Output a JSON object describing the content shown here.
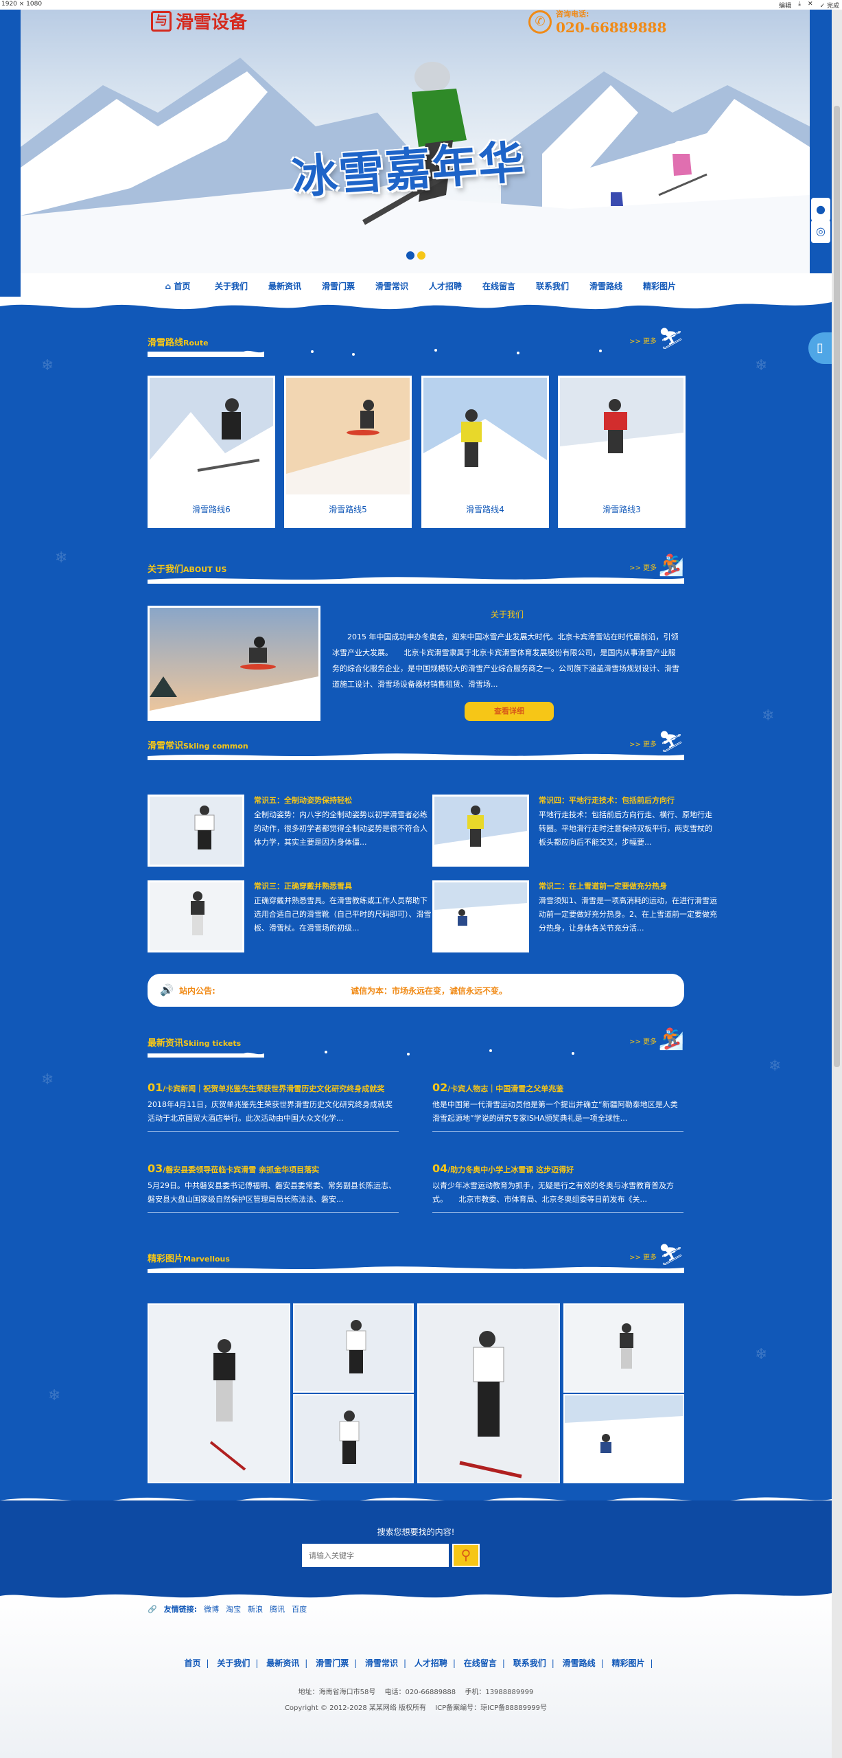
{
  "viewer": {
    "dimensions": "1920 × 1080",
    "tools": [
      "编辑",
      "⤓",
      "✕",
      "✓ 完成"
    ]
  },
  "header": {
    "logo_text": "滑雪设备",
    "logo_mark": "与",
    "hotline_label": "咨询电话:",
    "hotline_number": "020-66889888"
  },
  "hero": {
    "title": "冰雪嘉年华"
  },
  "nav": {
    "items": [
      "首页",
      "关于我们",
      "最新资讯",
      "滑雪门票",
      "滑雪常识",
      "人才招聘",
      "在线留言",
      "联系我们",
      "滑雪路线",
      "精彩图片"
    ]
  },
  "sections": {
    "route": {
      "title": "滑雪路线",
      "en": "Route",
      "more": ">> 更多"
    },
    "about": {
      "title": "关于我们",
      "en": "ABOUT US",
      "more": ">> 更多"
    },
    "common": {
      "title": "滑雪常识",
      "en": "Skiing common",
      "more": ">> 更多"
    },
    "news": {
      "title": "最新资讯",
      "en": "Skiing tickets",
      "more": ">> 更多"
    },
    "gallery": {
      "title": "精彩图片",
      "en": "Marvellous",
      "more": ">> 更多"
    }
  },
  "routes": [
    "滑雪路线6",
    "滑雪路线5",
    "滑雪路线4",
    "滑雪路线3"
  ],
  "about": {
    "heading": "关于我们",
    "text": "2015 年中国成功申办冬奥会，迎来中国冰雪产业发展大时代。北京卡宾滑雪站在时代最前沿，引领冰雪产业大发展。　　北京卡宾滑雪隶属于北京卡宾滑雪体育发展股份有限公司，是国内从事滑雪产业服务的综合化服务企业，是中国规模较大的滑雪产业综合服务商之一。公司旗下涵盖滑雪场规划设计、滑雪道施工设计、滑雪场设备器材销售租赁、滑雪场...",
    "button": "查看详细"
  },
  "common": [
    {
      "title": "常识五：全制动姿势保持轻松",
      "desc": "全制动姿势：内八字的全制动姿势以初学滑雪者必练的动作，很多初学者都觉得全制动姿势是很不符合人体力学，其实主要是因为身体僵..."
    },
    {
      "title": "常识四：平地行走技术：包括前后方向行",
      "desc": "平地行走技术：包括前后方向行走、横行、原地行走转圈。平地滑行走时注意保持双板平行，两支雪杖的板头都应向后不能交叉，步幅要..."
    },
    {
      "title": "常识三：正确穿戴并熟悉雪具",
      "desc": "正确穿戴并熟悉雪具。在滑雪教练或工作人员帮助下选用合适自己的滑雪靴（自己平时的尺码即可）、滑雪板、滑雪杖。在滑雪场的初级..."
    },
    {
      "title": "常识二：在上雪道前一定要做充分热身",
      "desc": "滑雪须知1、滑雪是一项高消耗的运动，在进行滑雪运动前一定要做好充分热身。2、在上雪道前一定要做充分热身，让身体各关节充分活..."
    }
  ],
  "notice": {
    "label": "站内公告:",
    "message": "诚信为本：市场永远在变，诚信永远不变。"
  },
  "news": [
    {
      "num": "01",
      "title": "/卡宾新闻｜祝贺单兆鉴先生荣获世界滑雪历史文化研究终身成就奖",
      "desc": "2018年4月11日，庆贺单兆鉴先生荣获世界滑雪历史文化研究终身成就奖活动于北京国贸大酒店举行。此次活动由中国大众文化学..."
    },
    {
      "num": "02",
      "title": "/卡宾人物志｜中国滑雪之父单兆鉴",
      "desc": "他是中国第一代滑雪运动员他是第一个提出并确立“新疆阿勒泰地区是人类滑雪起源地”学说的研究专家ISHA颁奖典礼是一项全球性..."
    },
    {
      "num": "03",
      "title": "/磐安县委领导莅临卡宾滑雪 亲抓金华项目落实",
      "desc": "5月29日。中共磐安县委书记傅福明、磐安县委常委、常务副县长陈运志、磐安县大盘山国家级自然保护区管理局局长陈法法、磐安..."
    },
    {
      "num": "04",
      "title": "/助力冬奥中小学上冰雪课 这步迈得好",
      "desc": "以青少年冰雪运动教育为抓手，无疑是行之有效的冬奥与冰雪教育普及方式。　　北京市教委、市体育局、北京冬奥组委等日前发布《关..."
    }
  ],
  "search": {
    "label": "搜索您想要找的内容!",
    "placeholder": "请输入关键字"
  },
  "links": {
    "label": "友情链接:",
    "items": [
      "微博",
      "淘宝",
      "新浪",
      "腾讯",
      "百度"
    ]
  },
  "footer": {
    "nav": [
      "首页",
      "关于我们",
      "最新资讯",
      "滑雪门票",
      "滑雪常识",
      "人才招聘",
      "在线留言",
      "联系我们",
      "滑雪路线",
      "精彩图片"
    ],
    "address": "地址：海南省海口市58号　 电话：020-66889888　 手机：13988889999",
    "copyright": "Copyright © 2012-2028 某某网络 版权所有　 ICP备案编号：琼ICP备88889999号"
  },
  "colors": {
    "primary": "#1158b8",
    "accent": "#f6c617",
    "orange": "#f08a16",
    "red": "#d52a1e"
  }
}
